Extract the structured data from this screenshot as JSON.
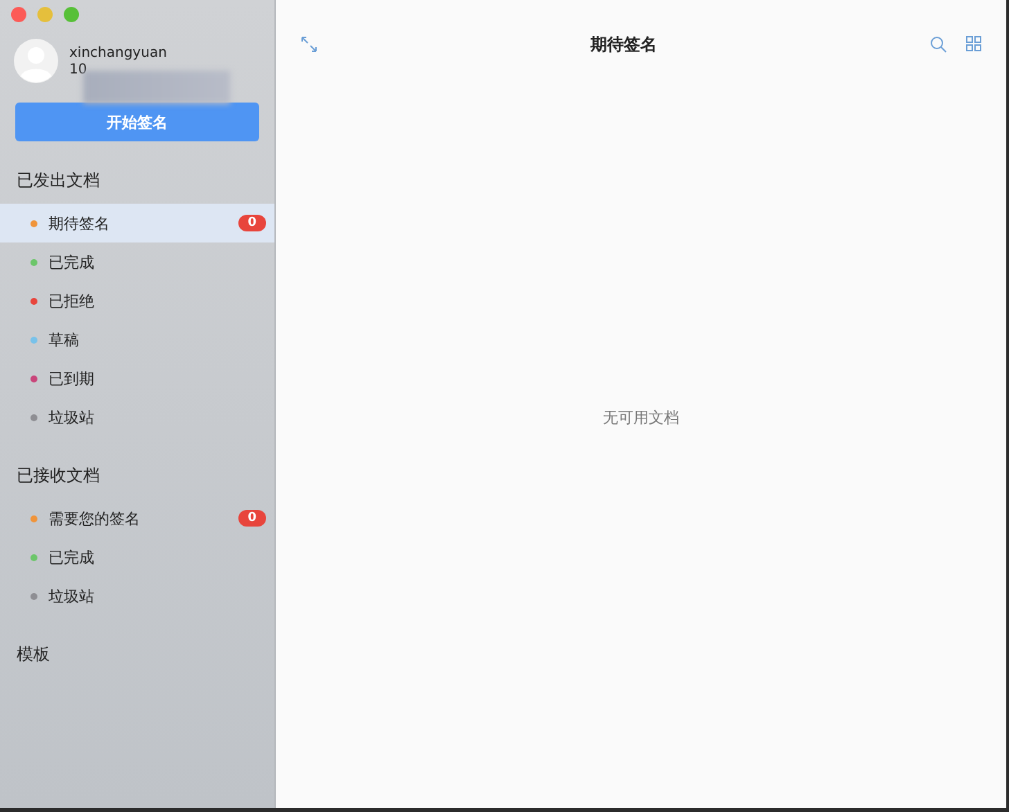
{
  "user": {
    "name": "xinchangyuan",
    "account": "10"
  },
  "start_button": "开始签名",
  "sections": [
    {
      "title": "已发出文档",
      "items": [
        {
          "label": "期待签名",
          "color": "#f0943a",
          "selected": true,
          "badge": "0"
        },
        {
          "label": "已完成",
          "color": "#6cc66a",
          "selected": false
        },
        {
          "label": "已拒绝",
          "color": "#e8453c",
          "selected": false
        },
        {
          "label": "草稿",
          "color": "#78c2ea",
          "selected": false
        },
        {
          "label": "已到期",
          "color": "#c9457a",
          "selected": false
        },
        {
          "label": "垃圾站",
          "color": "#8e8e93",
          "selected": false
        }
      ]
    },
    {
      "title": "已接收文档",
      "items": [
        {
          "label": "需要您的签名",
          "color": "#f0943a",
          "selected": false,
          "badge": "0"
        },
        {
          "label": "已完成",
          "color": "#6cc66a",
          "selected": false
        },
        {
          "label": "垃圾站",
          "color": "#8e8e93",
          "selected": false
        }
      ]
    },
    {
      "title": "模板"
    }
  ],
  "main": {
    "title": "期待签名",
    "empty_message": "无可用文档"
  }
}
